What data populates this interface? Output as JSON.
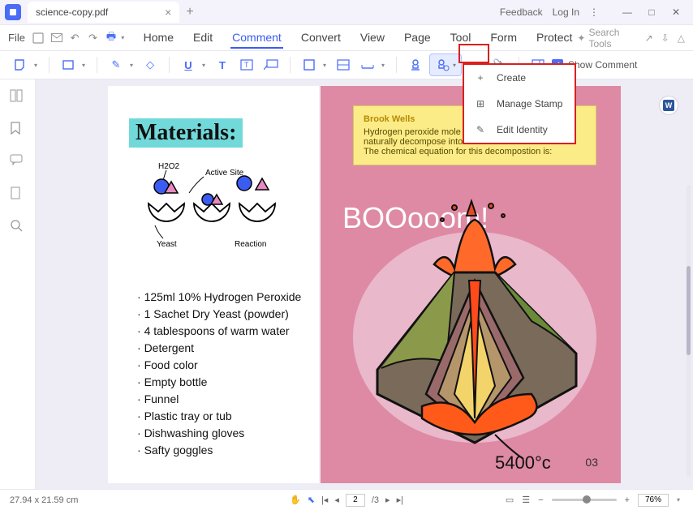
{
  "titlebar": {
    "filename": "science-copy.pdf",
    "feedback": "Feedback",
    "login": "Log In"
  },
  "menu": {
    "file": "File",
    "items": [
      "Home",
      "Edit",
      "Comment",
      "Convert",
      "View",
      "Page",
      "Tool",
      "Form",
      "Protect"
    ],
    "active_index": 2,
    "search_placeholder": "Search Tools"
  },
  "toolbar": {
    "show_comment": "Show Comment"
  },
  "dropdown": {
    "items": [
      {
        "icon": "+",
        "label": "Create"
      },
      {
        "icon": "⊞",
        "label": "Manage Stamp"
      },
      {
        "icon": "✎",
        "label": "Edit Identity"
      }
    ]
  },
  "page_left": {
    "title": "Materials:",
    "diagram_labels": {
      "h2o2": "H2O2",
      "active_site": "Active Site",
      "yeast": "Yeast",
      "reaction": "Reaction"
    },
    "list": [
      "125ml 10% Hydrogen Peroxide",
      "1 Sachet Dry Yeast (powder)",
      "4 tablespoons of warm water",
      "Detergent",
      "Food color",
      "Empty bottle",
      "Funnel",
      "Plastic tray or tub",
      "Dishwashing gloves",
      "Safty goggles"
    ]
  },
  "page_right": {
    "note": {
      "author": "Brook Wells",
      "l1": "Hydrogen peroxide mole",
      "l2": "naturally decompose into",
      "l3": "The chemical equation for this decompostion is:"
    },
    "boom": "BOOooom!",
    "temp": "5400°c",
    "pagenum": "03"
  },
  "status": {
    "dim": "27.94 x 21.59 cm",
    "page_current": "2",
    "page_total": "/3",
    "zoom": "76%"
  }
}
